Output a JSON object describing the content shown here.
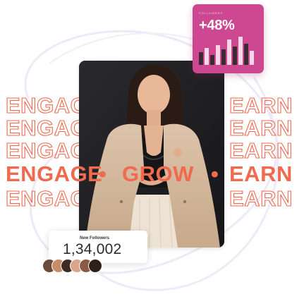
{
  "headline": {
    "word1": "ENGAGE",
    "word2": "GROW",
    "word3": "EARN",
    "separator": "•"
  },
  "growth_card": {
    "label": "FOLLOWERS",
    "change": "+48%",
    "bars_bg": "#cd4891"
  },
  "followers_card": {
    "title": "New Followers",
    "count": "1,34,002"
  },
  "avatars": {
    "icons": [
      "avatar-1",
      "avatar-2",
      "avatar-3",
      "avatar-4",
      "avatar-5"
    ]
  },
  "colors": {
    "accent": "#ef6a4f",
    "card_pink": "#cd4891",
    "swirl": "#eee9f7"
  }
}
